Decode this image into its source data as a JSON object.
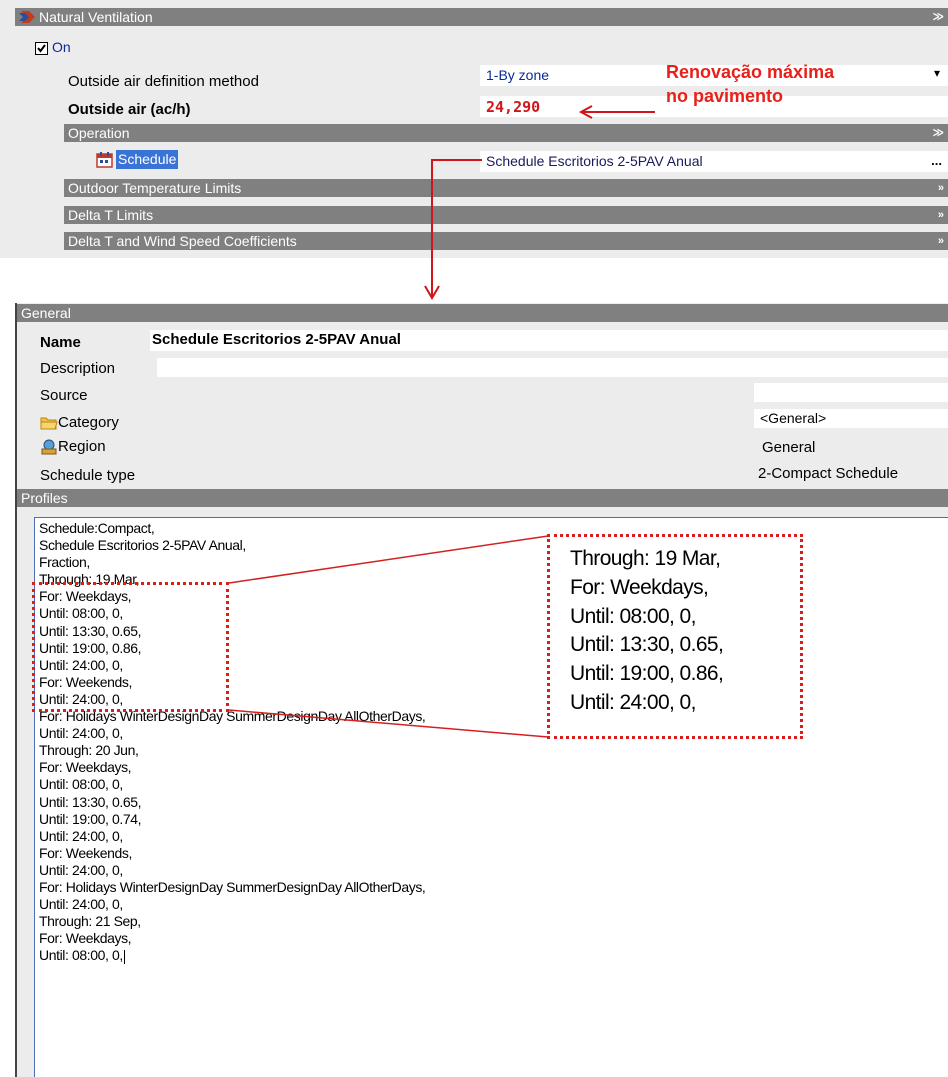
{
  "natural_ventilation": {
    "title": "Natural Ventilation",
    "on_label": "On",
    "on_checked": true,
    "rows": {
      "method_label": "Outside air definition method",
      "method_value": "1-By zone",
      "outside_air_label": "Outside air (ac/h)",
      "outside_air_value": "24,290"
    },
    "operation_title": "Operation",
    "schedule_label": "Schedule",
    "schedule_value": "Schedule Escritorios 2-5PAV Anual",
    "schedule_button": "...",
    "collapsed_sections": [
      "Outdoor Temperature Limits",
      "Delta T Limits",
      "Delta T and Wind Speed Coefficients"
    ]
  },
  "annotation": {
    "line1": "Renovação máxima",
    "line2": "no pavimento",
    "color": "#e8201a"
  },
  "general": {
    "title": "General",
    "name_label": "Name",
    "name_value": "Schedule Escritorios 2-5PAV Anual",
    "description_label": "Description",
    "description_value": "",
    "source_label": "Source",
    "source_value": "",
    "category_label": "Category",
    "category_value": "<General>",
    "region_label": "Region",
    "region_value": "General",
    "schedule_type_label": "Schedule type",
    "schedule_type_value": "2-Compact Schedule"
  },
  "profiles": {
    "title": "Profiles",
    "lines": [
      "Schedule:Compact,",
      "Schedule Escritorios 2-5PAV Anual,",
      "Fraction,",
      "Through: 19 Mar,",
      "For: Weekdays,",
      "Until: 08:00, 0,",
      "Until: 13:30, 0.65,",
      "Until: 19:00, 0.86,",
      "Until: 24:00, 0,",
      "For: Weekends,",
      "Until: 24:00, 0,",
      "For: Holidays WinterDesignDay SummerDesignDay AllOtherDays,",
      "Until: 24:00, 0,",
      "Through: 20 Jun,",
      "For: Weekdays,",
      "Until: 08:00, 0,",
      "Until: 13:30, 0.65,",
      "Until: 19:00, 0.74,",
      "Until: 24:00, 0,",
      "For: Weekends,",
      "Until: 24:00, 0,",
      "For: Holidays WinterDesignDay SummerDesignDay AllOtherDays,",
      "Until: 24:00, 0,",
      "Through: 21 Sep,",
      "For: Weekdays,",
      "Until: 08:00, 0,"
    ]
  },
  "zoom_box": {
    "lines": [
      "Through: 19 Mar,",
      "For: Weekdays,",
      "Until: 08:00, 0,",
      "Until: 13:30, 0.65,",
      "Until: 19:00, 0.86,",
      "Until: 24:00, 0,"
    ]
  }
}
